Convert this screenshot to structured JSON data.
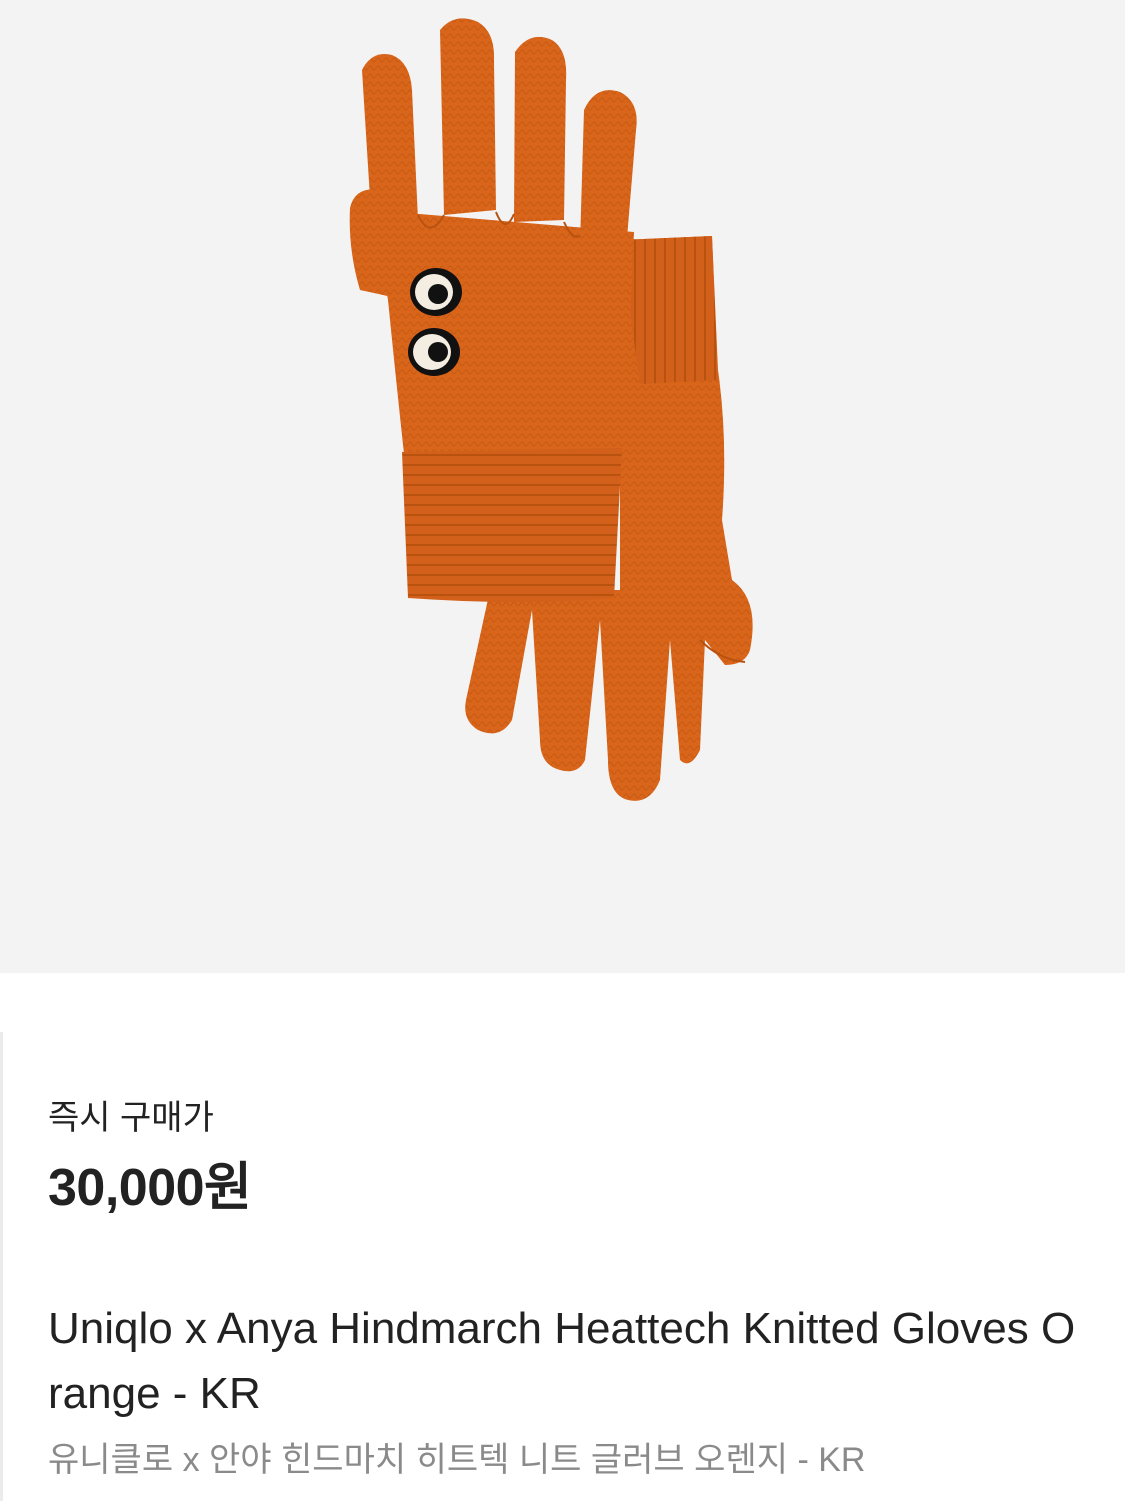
{
  "product": {
    "image_alt": "orange knitted gloves with eyes",
    "colors": {
      "image_bg": "#f4f3f4",
      "glove": "#d9651a",
      "glove_shadow": "#b8520f",
      "text_primary": "#222222",
      "text_secondary": "#8a8a8a"
    }
  },
  "price": {
    "label": "즉시 구매가",
    "value": "30,000원"
  },
  "name": {
    "en": "Uniqlo x Anya Hindmarch Heattech Knitted Gloves Orange - KR",
    "ko": "유니클로 x 안야 힌드마치 히트텍 니트 글러브 오렌지 - KR"
  }
}
